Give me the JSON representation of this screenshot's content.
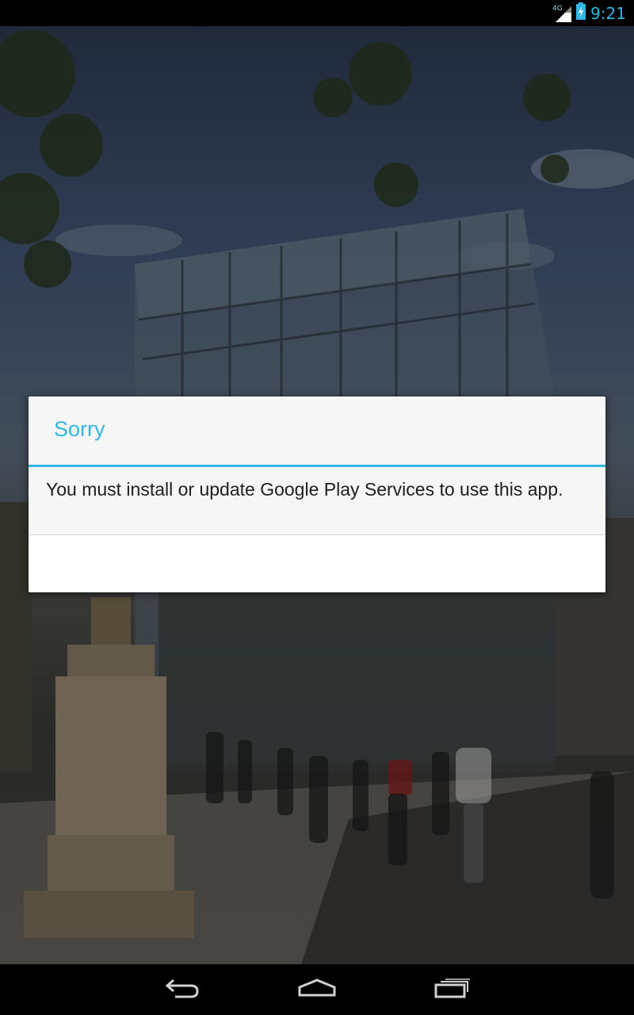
{
  "status_bar": {
    "network_type": "4G",
    "time": "9:21",
    "icons": [
      "signal-icon",
      "battery-charging-icon"
    ]
  },
  "dialog": {
    "title": "Sorry",
    "message": "You must install or update Google Play Services to use this app."
  },
  "navigation": {
    "buttons": [
      "back-icon",
      "home-icon",
      "recent-apps-icon"
    ]
  },
  "colors": {
    "accent": "#33b5e5",
    "dialog_background": "#f6f6f6",
    "message_text": "#1e1e1e"
  }
}
